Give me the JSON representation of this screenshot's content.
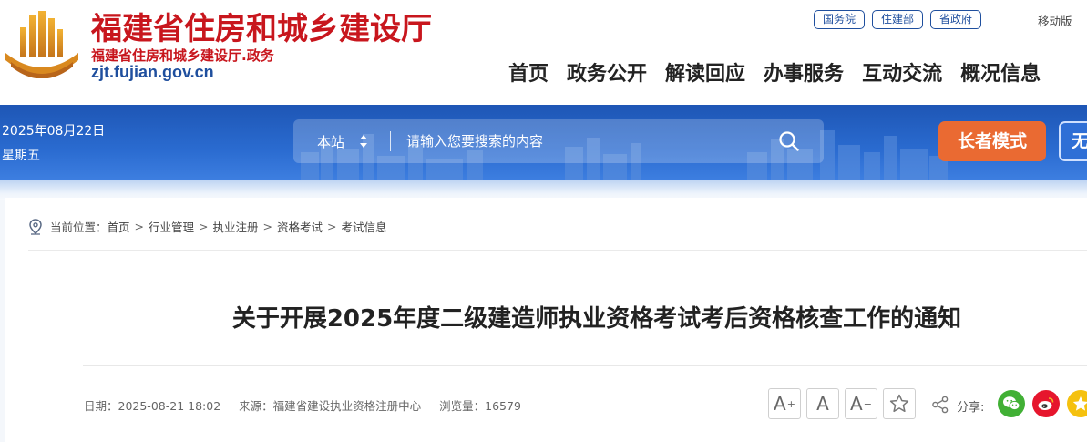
{
  "header": {
    "site_title": "福建省住房和城乡建设厅",
    "site_subtitle": "福建省住房和城乡建设厅.政务",
    "site_domain": "zjt.fujian.gov.cn",
    "top_links": [
      "国务院",
      "住建部",
      "省政府"
    ],
    "mobile_label": "移动版",
    "nav": [
      "首页",
      "政务公开",
      "解读回应",
      "办事服务",
      "互动交流",
      "概况信息"
    ]
  },
  "banner": {
    "date": "2025年08月22日",
    "weekday": "星期五",
    "search_scope": "本站",
    "search_placeholder": "请输入您要搜索的内容",
    "elder_mode_label": "长者模式",
    "accessibility_label": "无障碍"
  },
  "breadcrumb": {
    "prefix": "当前位置：",
    "items": [
      "首页",
      "行业管理",
      "执业注册",
      "资格考试",
      "考试信息"
    ],
    "separator": ">"
  },
  "article": {
    "title": "关于开展2025年度二级建造师执业资格考试考后资格核查工作的通知",
    "date_text": "日期：2025-08-21 18:02",
    "source_text": "来源：福建省建设执业资格注册中心",
    "views_text": "浏览量：16579"
  },
  "tools": {
    "font_increase": "A",
    "font_increase_mark": "+",
    "font_reset": "A",
    "font_decrease": "A",
    "font_decrease_mark": "−",
    "share_label": "分享:",
    "icons": [
      "font-increase-icon",
      "font-reset-icon",
      "font-decrease-icon",
      "star-icon",
      "share-icon",
      "wechat-icon",
      "weibo-icon",
      "qzone-icon"
    ]
  },
  "colors": {
    "brand_red": "#c8161d",
    "brand_blue": "#1f4f9e",
    "banner_blue": "#2a6bd0",
    "elder_orange": "#ea6a32",
    "wechat_green": "#41b035",
    "weibo_red": "#e6162d",
    "qzone_yellow": "#f5c10f"
  }
}
